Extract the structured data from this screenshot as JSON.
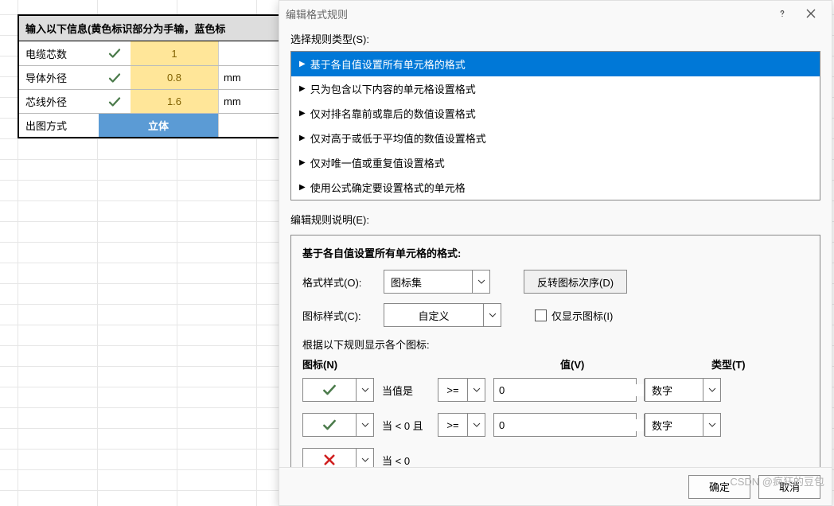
{
  "sheet": {
    "header": "输入以下信息(黄色标识部分为手输，蓝色标",
    "rows": [
      {
        "label": "电缆芯数",
        "icon": "check",
        "value": "1",
        "unit": ""
      },
      {
        "label": "导体外径",
        "icon": "check",
        "value": "0.8",
        "unit": "mm"
      },
      {
        "label": "芯线外径",
        "icon": "check",
        "value": "1.6",
        "unit": "mm"
      },
      {
        "label": "出图方式",
        "icon": "",
        "value": "立体",
        "unit": "",
        "blue": true
      }
    ]
  },
  "dialog": {
    "title": "编辑格式规则",
    "section_select_label": "选择规则类型(S):",
    "rule_types": [
      "基于各自值设置所有单元格的格式",
      "只为包含以下内容的单元格设置格式",
      "仅对排名靠前或靠后的数值设置格式",
      "仅对高于或低于平均值的数值设置格式",
      "仅对唯一值或重复值设置格式",
      "使用公式确定要设置格式的单元格"
    ],
    "rule_types_selected": 0,
    "section_edit_label": "编辑规则说明(E):",
    "panel_title": "基于各自值设置所有单元格的格式:",
    "format_style_label": "格式样式(O):",
    "format_style_value": "图标集",
    "reverse_button": "反转图标次序(D)",
    "icon_style_label": "图标样式(C):",
    "icon_style_value": "自定义",
    "show_icon_only_label": "仅显示图标(I)",
    "show_icon_only_checked": false,
    "rules_intro": "根据以下规则显示各个图标:",
    "col_icon": "图标(N)",
    "col_value": "值(V)",
    "col_type": "类型(T)",
    "icon_rules": [
      {
        "icon": "check",
        "label": "当值是",
        "op": ">=",
        "value": "0",
        "type": "数字"
      },
      {
        "icon": "check",
        "label": "当 < 0 且",
        "op": ">=",
        "value": "0",
        "type": "数字"
      },
      {
        "icon": "cross",
        "label": "当 < 0",
        "op": "",
        "value": "",
        "type": ""
      }
    ],
    "ok": "确定",
    "cancel": "取消"
  },
  "watermark": "CSDN @疯狂的豆包"
}
